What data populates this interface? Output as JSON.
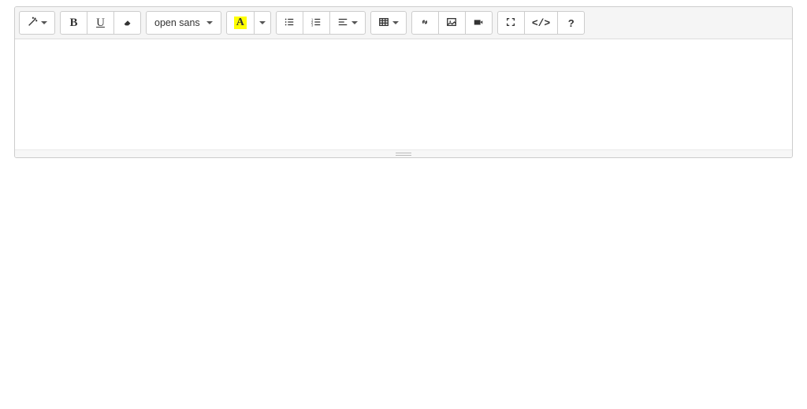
{
  "toolbar": {
    "style_label": "",
    "bold_label": "B",
    "underline_label": "U",
    "font_family_label": "open sans",
    "color_label": "A",
    "codeview_label": "</>",
    "help_label": "?"
  },
  "editor": {
    "content": ""
  },
  "colors": {
    "highlight": "#ffff00"
  }
}
